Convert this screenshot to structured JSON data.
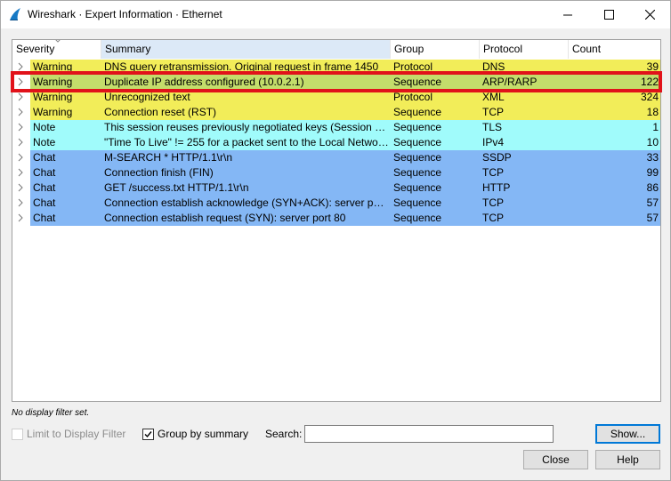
{
  "window": {
    "title": "Wireshark · Expert Information · Ethernet"
  },
  "table": {
    "columns": [
      "Severity",
      "Summary",
      "Group",
      "Protocol",
      "Count"
    ],
    "rows": [
      {
        "severity": "Warning",
        "summary": "DNS query retransmission. Original request in frame 1450",
        "group": "Protocol",
        "protocol": "DNS",
        "count": "39",
        "color": "#f2ed59"
      },
      {
        "severity": "Warning",
        "summary": "Duplicate IP address configured (10.0.2.1)",
        "group": "Sequence",
        "protocol": "ARP/RARP",
        "count": "122",
        "color": "#c3dd6b"
      },
      {
        "severity": "Warning",
        "summary": "Unrecognized text",
        "group": "Protocol",
        "protocol": "XML",
        "count": "324",
        "color": "#f2ed59"
      },
      {
        "severity": "Warning",
        "summary": "Connection reset (RST)",
        "group": "Sequence",
        "protocol": "TCP",
        "count": "18",
        "color": "#f2ed59"
      },
      {
        "severity": "Note",
        "summary": "This session reuses previously negotiated keys (Session res...",
        "group": "Sequence",
        "protocol": "TLS",
        "count": "1",
        "color": "#a0fbfb"
      },
      {
        "severity": "Note",
        "summary": "\"Time To Live\" != 255 for a packet sent to the Local Networ...",
        "group": "Sequence",
        "protocol": "IPv4",
        "count": "10",
        "color": "#a0fbfb"
      },
      {
        "severity": "Chat",
        "summary": "M-SEARCH * HTTP/1.1\\r\\n",
        "group": "Sequence",
        "protocol": "SSDP",
        "count": "33",
        "color": "#84b7f5"
      },
      {
        "severity": "Chat",
        "summary": "Connection finish (FIN)",
        "group": "Sequence",
        "protocol": "TCP",
        "count": "99",
        "color": "#84b7f5"
      },
      {
        "severity": "Chat",
        "summary": "GET /success.txt HTTP/1.1\\r\\n",
        "group": "Sequence",
        "protocol": "HTTP",
        "count": "86",
        "color": "#84b7f5"
      },
      {
        "severity": "Chat",
        "summary": "Connection establish acknowledge (SYN+ACK): server por...",
        "group": "Sequence",
        "protocol": "TCP",
        "count": "57",
        "color": "#84b7f5"
      },
      {
        "severity": "Chat",
        "summary": "Connection establish request (SYN): server port 80",
        "group": "Sequence",
        "protocol": "TCP",
        "count": "57",
        "color": "#84b7f5"
      }
    ]
  },
  "filter_note": "No display filter set.",
  "controls": {
    "limit_label": "Limit to Display Filter",
    "group_label": "Group by summary",
    "search_label": "Search:",
    "search_value": "",
    "show_label": "Show...",
    "close_label": "Close",
    "help_label": "Help"
  },
  "colors": {
    "highlight_border": "#e1121a",
    "accent": "#0078d7"
  }
}
